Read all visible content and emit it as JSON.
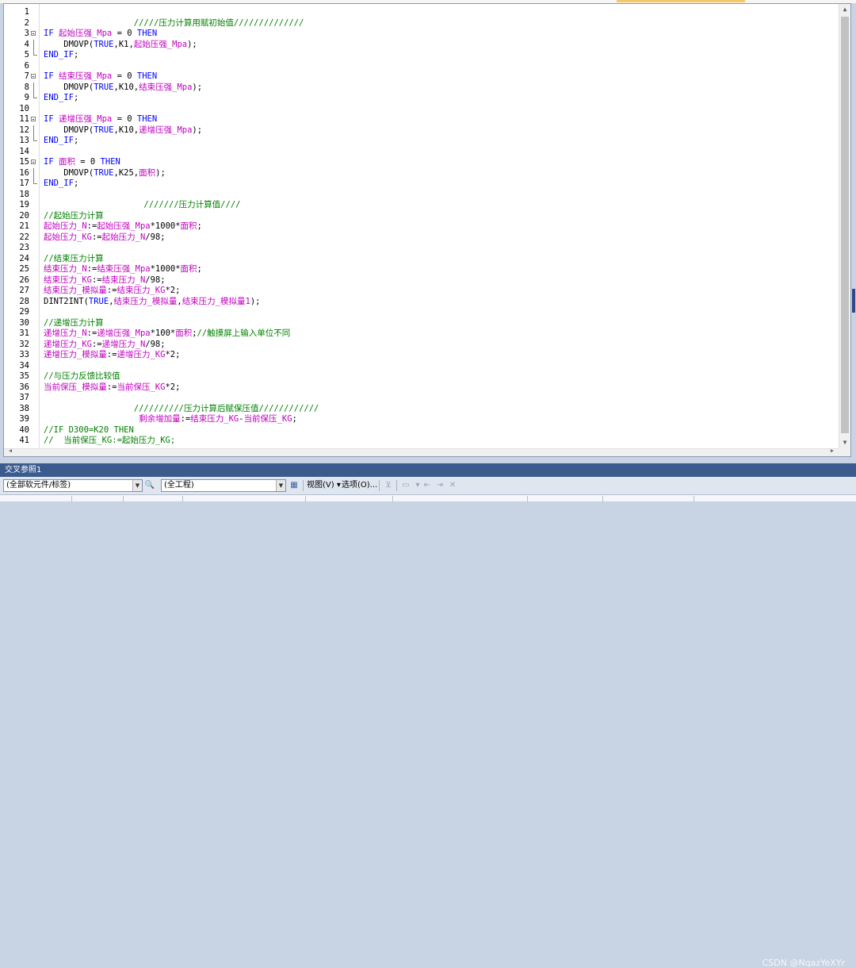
{
  "editor": {
    "lines": [
      {
        "n": "1",
        "fold": "",
        "tokens": []
      },
      {
        "n": "2",
        "fold": "",
        "tokens": [
          {
            "t": "c",
            "v": "                  /////压力计算用赋初始值//////////////"
          }
        ]
      },
      {
        "n": "3",
        "fold": "open",
        "tokens": [
          {
            "t": "k",
            "v": "IF "
          },
          {
            "t": "v",
            "v": "起始压强_Mpa"
          },
          {
            "t": "p",
            "v": " = 0 "
          },
          {
            "t": "k",
            "v": "THEN"
          }
        ]
      },
      {
        "n": "4",
        "fold": "mid",
        "tokens": [
          {
            "t": "p",
            "v": "    DMOVP("
          },
          {
            "t": "k",
            "v": "TRUE"
          },
          {
            "t": "p",
            "v": ",K1,"
          },
          {
            "t": "v",
            "v": "起始压强_Mpa"
          },
          {
            "t": "p",
            "v": ");"
          }
        ]
      },
      {
        "n": "5",
        "fold": "end",
        "tokens": [
          {
            "t": "k",
            "v": "END_IF"
          },
          {
            "t": "p",
            "v": ";"
          }
        ]
      },
      {
        "n": "6",
        "fold": "",
        "tokens": []
      },
      {
        "n": "7",
        "fold": "open",
        "tokens": [
          {
            "t": "k",
            "v": "IF "
          },
          {
            "t": "v",
            "v": "结束压强_Mpa"
          },
          {
            "t": "p",
            "v": " = 0 "
          },
          {
            "t": "k",
            "v": "THEN"
          }
        ]
      },
      {
        "n": "8",
        "fold": "mid",
        "tokens": [
          {
            "t": "p",
            "v": "    DMOVP("
          },
          {
            "t": "k",
            "v": "TRUE"
          },
          {
            "t": "p",
            "v": ",K10,"
          },
          {
            "t": "v",
            "v": "结束压强_Mpa"
          },
          {
            "t": "p",
            "v": ");"
          }
        ]
      },
      {
        "n": "9",
        "fold": "end",
        "tokens": [
          {
            "t": "k",
            "v": "END_IF"
          },
          {
            "t": "p",
            "v": ";"
          }
        ]
      },
      {
        "n": "10",
        "fold": "",
        "tokens": []
      },
      {
        "n": "11",
        "fold": "open",
        "tokens": [
          {
            "t": "k",
            "v": "IF "
          },
          {
            "t": "v",
            "v": "递增压强_Mpa"
          },
          {
            "t": "p",
            "v": " = 0 "
          },
          {
            "t": "k",
            "v": "THEN"
          }
        ]
      },
      {
        "n": "12",
        "fold": "mid",
        "tokens": [
          {
            "t": "p",
            "v": "    DMOVP("
          },
          {
            "t": "k",
            "v": "TRUE"
          },
          {
            "t": "p",
            "v": ",K10,"
          },
          {
            "t": "v",
            "v": "递增压强_Mpa"
          },
          {
            "t": "p",
            "v": ");"
          }
        ]
      },
      {
        "n": "13",
        "fold": "end",
        "tokens": [
          {
            "t": "k",
            "v": "END_IF"
          },
          {
            "t": "p",
            "v": ";"
          }
        ]
      },
      {
        "n": "14",
        "fold": "",
        "tokens": []
      },
      {
        "n": "15",
        "fold": "open",
        "tokens": [
          {
            "t": "k",
            "v": "IF "
          },
          {
            "t": "v",
            "v": "面积"
          },
          {
            "t": "p",
            "v": " = 0 "
          },
          {
            "t": "k",
            "v": "THEN"
          }
        ]
      },
      {
        "n": "16",
        "fold": "mid",
        "tokens": [
          {
            "t": "p",
            "v": "    DMOVP("
          },
          {
            "t": "k",
            "v": "TRUE"
          },
          {
            "t": "p",
            "v": ",K25,"
          },
          {
            "t": "v",
            "v": "面积"
          },
          {
            "t": "p",
            "v": ");"
          }
        ]
      },
      {
        "n": "17",
        "fold": "end",
        "tokens": [
          {
            "t": "k",
            "v": "END_IF"
          },
          {
            "t": "p",
            "v": ";"
          }
        ]
      },
      {
        "n": "18",
        "fold": "",
        "tokens": []
      },
      {
        "n": "19",
        "fold": "",
        "tokens": [
          {
            "t": "c",
            "v": "                    ///////压力计算值////"
          }
        ]
      },
      {
        "n": "20",
        "fold": "",
        "tokens": [
          {
            "t": "c",
            "v": "//起始压力计算"
          }
        ]
      },
      {
        "n": "21",
        "fold": "",
        "tokens": [
          {
            "t": "v",
            "v": "起始压力_N"
          },
          {
            "t": "p",
            "v": ":="
          },
          {
            "t": "v",
            "v": "起始压强_Mpa"
          },
          {
            "t": "p",
            "v": "*1000*"
          },
          {
            "t": "v",
            "v": "面积"
          },
          {
            "t": "p",
            "v": ";"
          }
        ]
      },
      {
        "n": "22",
        "fold": "",
        "tokens": [
          {
            "t": "v",
            "v": "起始压力_KG"
          },
          {
            "t": "p",
            "v": ":="
          },
          {
            "t": "v",
            "v": "起始压力_N"
          },
          {
            "t": "p",
            "v": "/98;"
          }
        ]
      },
      {
        "n": "23",
        "fold": "",
        "tokens": []
      },
      {
        "n": "24",
        "fold": "",
        "tokens": [
          {
            "t": "c",
            "v": "//结束压力计算"
          }
        ]
      },
      {
        "n": "25",
        "fold": "",
        "tokens": [
          {
            "t": "v",
            "v": "结束压力_N"
          },
          {
            "t": "p",
            "v": ":="
          },
          {
            "t": "v",
            "v": "结束压强_Mpa"
          },
          {
            "t": "p",
            "v": "*1000*"
          },
          {
            "t": "v",
            "v": "面积"
          },
          {
            "t": "p",
            "v": ";"
          }
        ]
      },
      {
        "n": "26",
        "fold": "",
        "tokens": [
          {
            "t": "v",
            "v": "结束压力_KG"
          },
          {
            "t": "p",
            "v": ":="
          },
          {
            "t": "v",
            "v": "结束压力_N"
          },
          {
            "t": "p",
            "v": "/98;"
          }
        ]
      },
      {
        "n": "27",
        "fold": "",
        "tokens": [
          {
            "t": "v",
            "v": "结束压力_模拟量"
          },
          {
            "t": "p",
            "v": ":="
          },
          {
            "t": "v",
            "v": "结束压力_KG"
          },
          {
            "t": "p",
            "v": "*2;"
          }
        ]
      },
      {
        "n": "28",
        "fold": "",
        "tokens": [
          {
            "t": "p",
            "v": "DINT2INT("
          },
          {
            "t": "k",
            "v": "TRUE"
          },
          {
            "t": "p",
            "v": ","
          },
          {
            "t": "v",
            "v": "结束压力_模拟量"
          },
          {
            "t": "p",
            "v": ","
          },
          {
            "t": "v",
            "v": "结束压力_模拟量1"
          },
          {
            "t": "p",
            "v": ");"
          }
        ]
      },
      {
        "n": "29",
        "fold": "",
        "tokens": []
      },
      {
        "n": "30",
        "fold": "",
        "tokens": [
          {
            "t": "c",
            "v": "//递增压力计算"
          }
        ]
      },
      {
        "n": "31",
        "fold": "",
        "tokens": [
          {
            "t": "v",
            "v": "递增压力_N"
          },
          {
            "t": "p",
            "v": ":="
          },
          {
            "t": "v",
            "v": "递增压强_Mpa"
          },
          {
            "t": "p",
            "v": "*100*"
          },
          {
            "t": "v",
            "v": "面积"
          },
          {
            "t": "p",
            "v": ";"
          },
          {
            "t": "c",
            "v": "//触摸屏上输入单位不同"
          }
        ]
      },
      {
        "n": "32",
        "fold": "",
        "tokens": [
          {
            "t": "v",
            "v": "递增压力_KG"
          },
          {
            "t": "p",
            "v": ":="
          },
          {
            "t": "v",
            "v": "递增压力_N"
          },
          {
            "t": "p",
            "v": "/98;"
          }
        ]
      },
      {
        "n": "33",
        "fold": "",
        "tokens": [
          {
            "t": "v",
            "v": "递增压力_模拟量"
          },
          {
            "t": "p",
            "v": ":="
          },
          {
            "t": "v",
            "v": "递增压力_KG"
          },
          {
            "t": "p",
            "v": "*2;"
          }
        ]
      },
      {
        "n": "34",
        "fold": "",
        "tokens": []
      },
      {
        "n": "35",
        "fold": "",
        "tokens": [
          {
            "t": "c",
            "v": "//与压力反馈比较值"
          }
        ]
      },
      {
        "n": "36",
        "fold": "",
        "tokens": [
          {
            "t": "v",
            "v": "当前保压_模拟量"
          },
          {
            "t": "p",
            "v": ":="
          },
          {
            "t": "v",
            "v": "当前保压_KG"
          },
          {
            "t": "p",
            "v": "*2;"
          }
        ]
      },
      {
        "n": "37",
        "fold": "",
        "tokens": []
      },
      {
        "n": "38",
        "fold": "",
        "tokens": [
          {
            "t": "c",
            "v": "                  //////////压力计算后赋保压值////////////"
          }
        ]
      },
      {
        "n": "39",
        "fold": "",
        "tokens": [
          {
            "t": "p",
            "v": "                   "
          },
          {
            "t": "v",
            "v": "剩余增加量"
          },
          {
            "t": "p",
            "v": ":="
          },
          {
            "t": "v",
            "v": "结束压力_KG"
          },
          {
            "t": "p",
            "v": "-"
          },
          {
            "t": "v",
            "v": "当前保压_KG"
          },
          {
            "t": "p",
            "v": ";"
          }
        ]
      },
      {
        "n": "40",
        "fold": "",
        "tokens": [
          {
            "t": "c",
            "v": "//IF D300=K20 THEN"
          }
        ]
      },
      {
        "n": "41",
        "fold": "",
        "tokens": [
          {
            "t": "c",
            "v": "//  当前保压_KG:=起始压力_KG;"
          }
        ]
      }
    ]
  },
  "panel": {
    "title": "交叉参照1"
  },
  "toolbar": {
    "scope_combo": "(全部软元件/标签)",
    "project_combo": "(全工程)",
    "view_btn": "视图(V) ▾",
    "options_btn": "选项(O)..."
  },
  "watermark": "CSDN @NqazYeXYr",
  "icons": {
    "search": "search-icon",
    "filter": "filter-icon"
  }
}
